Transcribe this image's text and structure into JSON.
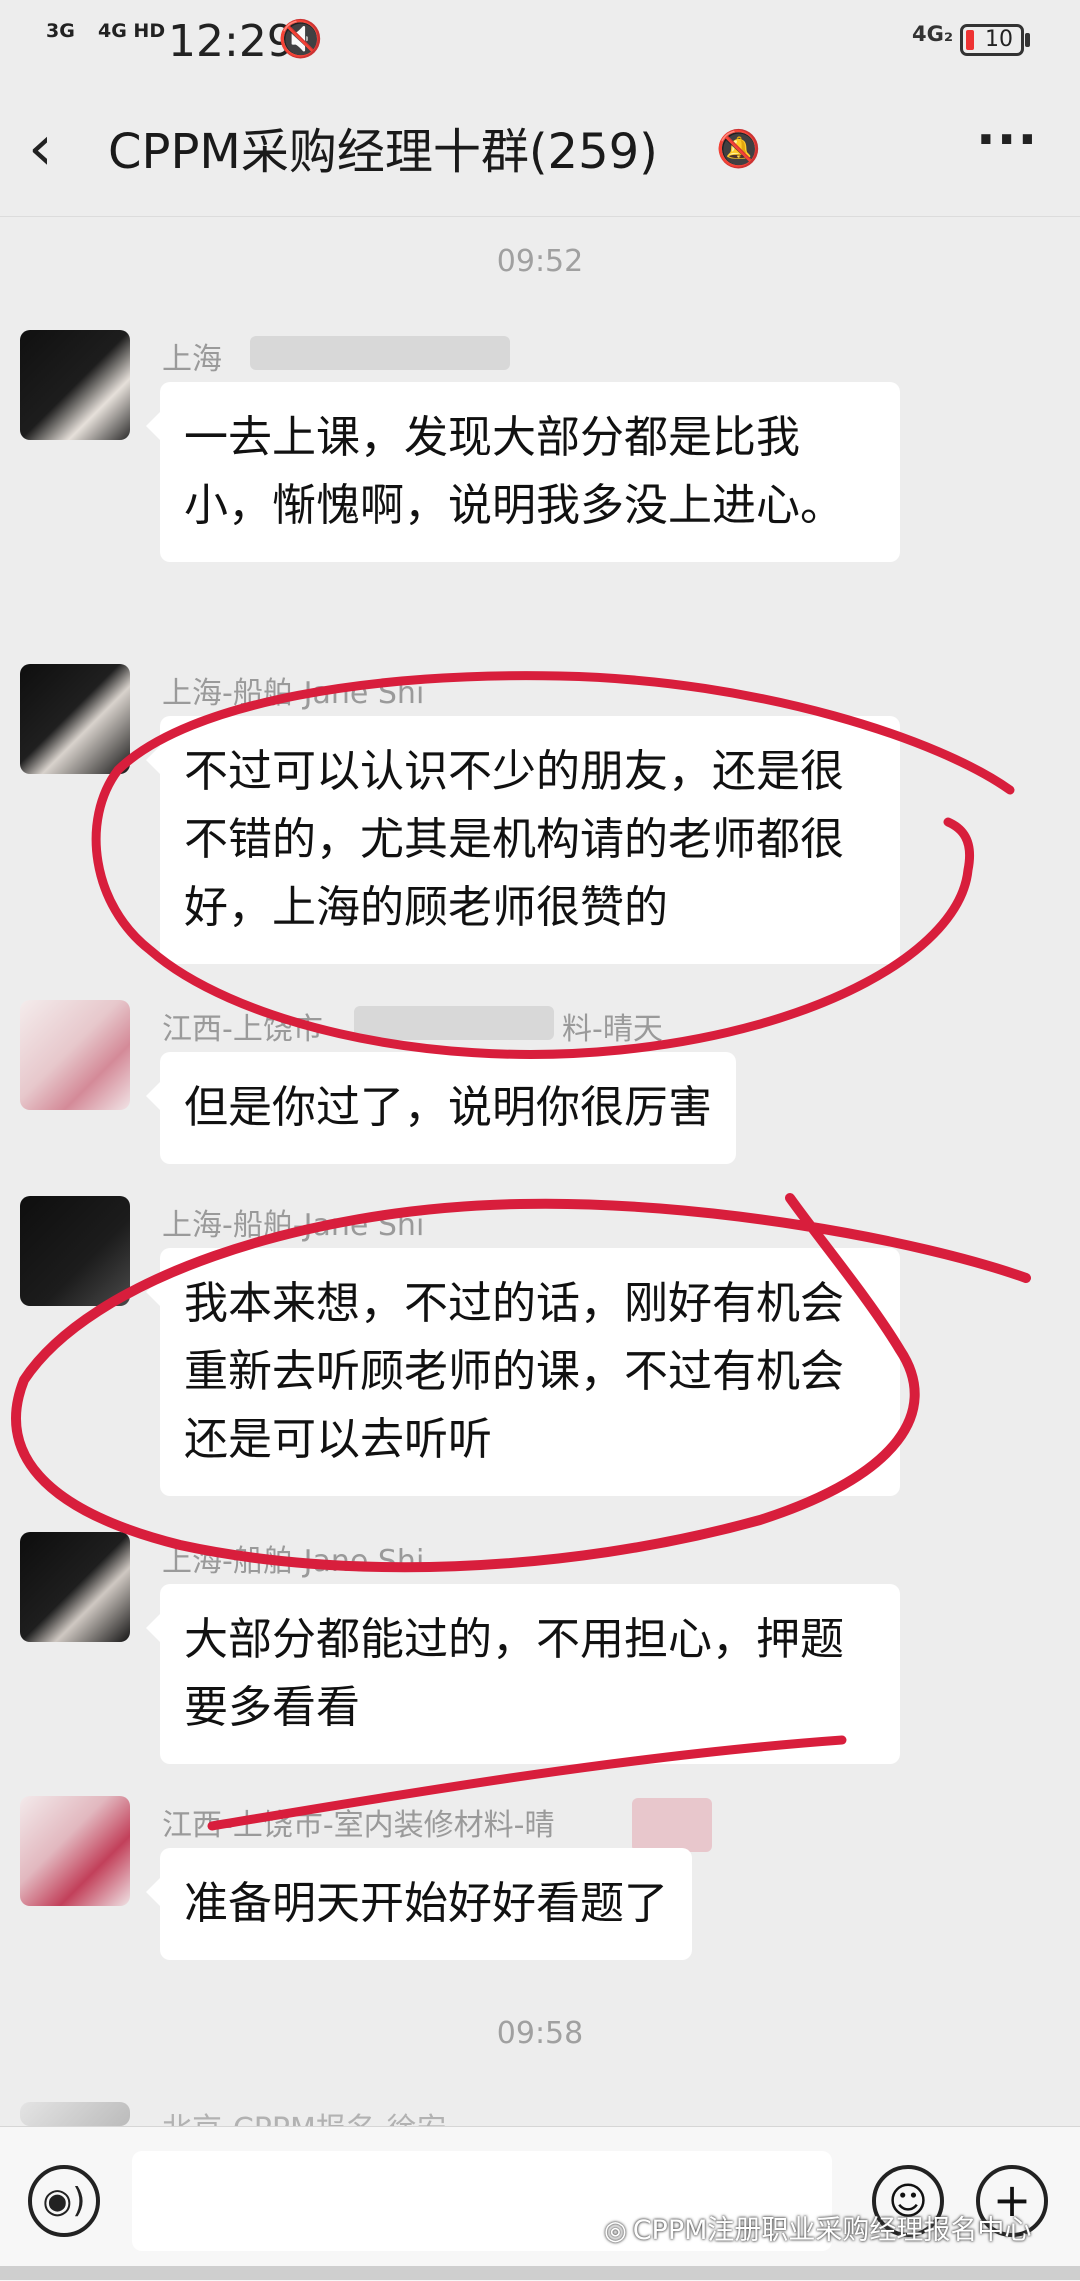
{
  "status_bar": {
    "signal1": "3G",
    "signal2": "4G HD",
    "time": "12:29",
    "network": "4G₂",
    "battery": "10"
  },
  "nav": {
    "back_icon": "chevron-left-icon",
    "title": "CPPM采购经理十群(259)",
    "muted_icon": "muted-bell-icon",
    "more_icon": "more-dots-icon"
  },
  "timestamps": [
    "09:52",
    "09:58"
  ],
  "messages": [
    {
      "sender": "上海",
      "text": "一去上课，发现大部分都是比我小，惭愧啊，说明我多没上进心。"
    },
    {
      "sender": "上海-船舶-Jane Shi",
      "text": "不过可以认识不少的朋友，还是很不错的，尤其是机构请的老师都很好，上海的顾老师很赞的"
    },
    {
      "sender": "江西-上饶市",
      "sender_suffix": "料-晴天",
      "text": "但是你过了，说明你很厉害"
    },
    {
      "sender": "上海-船舶-Jane Shi",
      "text": "我本来想，不过的话，刚好有机会重新去听顾老师的课，不过有机会还是可以去听听"
    },
    {
      "sender": "上海-船舶-Jane Shi",
      "text": "大部分都能过的，不用担心，押题要多看看"
    },
    {
      "sender": "江西-上饶市-室内装修材料-晴",
      "text": "准备明天开始好好看题了"
    },
    {
      "sender": "北京-CPPM报名-徐安",
      "text": ""
    }
  ],
  "input_bar": {
    "voice_icon": "voice-icon",
    "emoji_icon": "emoji-icon",
    "plus_icon": "plus-icon"
  },
  "watermark": "CPPM注册职业采购经理报名中心",
  "annotation_color": "#d81e3c"
}
